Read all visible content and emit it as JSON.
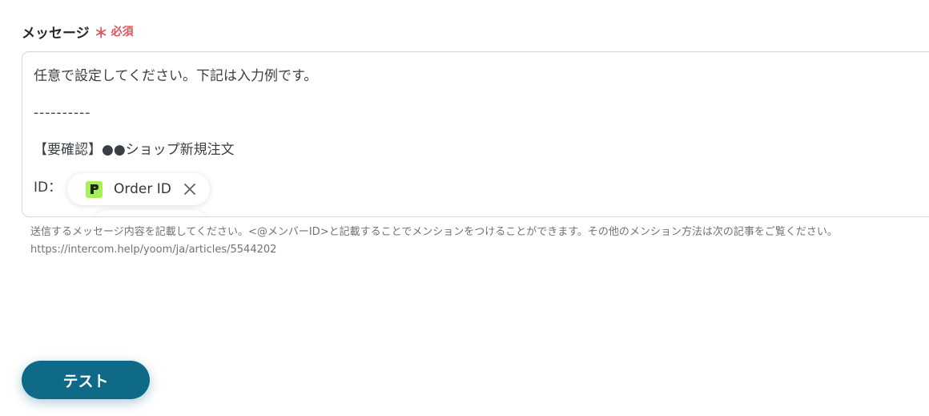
{
  "field": {
    "label": "メッセージ",
    "required_mark": "＊",
    "required_text": "必須"
  },
  "editor": {
    "lines": [
      "任意で設定してください。下記は入力例です。",
      "----------",
      "【要確認】●●ショップ新規注文",
      "ID："
    ],
    "chip": {
      "label": "Order ID",
      "icon": "app-logo-icon",
      "icon_color": "#a6f05a",
      "icon_letter": "P"
    }
  },
  "help": {
    "text": "送信するメッセージ内容を記載してください。<@メンバーID>と記載することでメンションをつけることができます。その他のメンション方法は次の記事をご覧ください。",
    "link": "https://intercom.help/yoom/ja/articles/5544202"
  },
  "actions": {
    "test_label": "テスト"
  },
  "colors": {
    "primary": "#0e6a86",
    "required": "#e0535f"
  }
}
